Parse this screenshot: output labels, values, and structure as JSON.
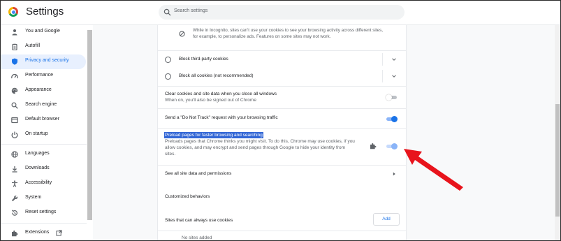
{
  "app": {
    "title": "Settings"
  },
  "search": {
    "placeholder": "Search settings"
  },
  "sidebar": {
    "items": [
      {
        "label": "You and Google",
        "icon": "person-icon"
      },
      {
        "label": "Autofill",
        "icon": "clipboard-icon"
      },
      {
        "label": "Privacy and security",
        "icon": "shield-icon",
        "active": true
      },
      {
        "label": "Performance",
        "icon": "speedometer-icon"
      },
      {
        "label": "Appearance",
        "icon": "palette-icon"
      },
      {
        "label": "Search engine",
        "icon": "search-icon"
      },
      {
        "label": "Default browser",
        "icon": "browser-icon"
      },
      {
        "label": "On startup",
        "icon": "power-icon"
      },
      {
        "label": "Languages",
        "icon": "globe-icon"
      },
      {
        "label": "Downloads",
        "icon": "download-icon"
      },
      {
        "label": "Accessibility",
        "icon": "accessibility-icon"
      },
      {
        "label": "System",
        "icon": "wrench-icon"
      },
      {
        "label": "Reset settings",
        "icon": "reset-icon"
      },
      {
        "label": "Extensions",
        "icon": "puzzle-icon"
      }
    ]
  },
  "main": {
    "incognito_note": {
      "line1": "While in Incognito, sites can't use your cookies to see your browsing activity across different sites,",
      "line2": "for example, to personalize ads. Features on some sites may not work."
    },
    "block_third_party": "Block third-party cookies",
    "block_all": "Block all cookies (not recommended)",
    "clear_cookies": {
      "title": "Clear cookies and site data when you close all windows",
      "sub": "When on, you'll also be signed out of Chrome",
      "state": "off"
    },
    "do_not_track": {
      "title": "Send a \"Do Not Track\" request with your browsing traffic",
      "state": "on"
    },
    "preload": {
      "title": "Preload pages for faster browsing and searching",
      "sub1": "Preloads pages that Chrome thinks you might visit. To do this, Chrome may use cookies, if you",
      "sub2": "allow cookies, and may encrypt and send pages through Google to hide your identity from",
      "sub3": "sites.",
      "state": "on-managed"
    },
    "see_all": "See all site data and permissions",
    "customized_behaviors": "Customized behaviors",
    "always_use_cookies": "Sites that can always use cookies",
    "add_label": "Add",
    "no_sites": "No sites added"
  },
  "colors": {
    "accent": "#1a73e8",
    "highlight": "#3367d6",
    "arrow": "#e8141c"
  }
}
